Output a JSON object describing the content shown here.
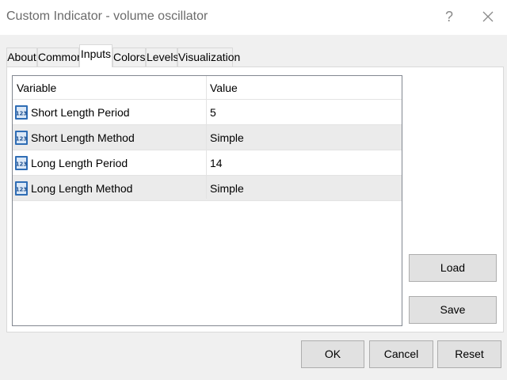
{
  "window": {
    "title": "Custom Indicator - volume oscillator",
    "help_glyph": "?",
    "close_glyph": "×"
  },
  "tabs": [
    {
      "label": "About",
      "active": false
    },
    {
      "label": "Common",
      "active": false
    },
    {
      "label": "Inputs",
      "active": true
    },
    {
      "label": "Colors",
      "active": false
    },
    {
      "label": "Levels",
      "active": false
    },
    {
      "label": "Visualization",
      "active": false
    }
  ],
  "inputs_table": {
    "headers": {
      "variable": "Variable",
      "value": "Value"
    },
    "rows": [
      {
        "variable": "Short Length Period",
        "value": "5",
        "icon": "numeric-123-icon"
      },
      {
        "variable": "Short Length Method",
        "value": "Simple",
        "icon": "numeric-123-icon"
      },
      {
        "variable": "Long Length Period",
        "value": "14",
        "icon": "numeric-123-icon"
      },
      {
        "variable": "Long Length Method",
        "value": "Simple",
        "icon": "numeric-123-icon"
      }
    ]
  },
  "side_buttons": {
    "load": "Load",
    "save": "Save"
  },
  "footer_buttons": {
    "ok": "OK",
    "cancel": "Cancel",
    "reset": "Reset"
  },
  "colors": {
    "row_shade": "#ebebeb",
    "icon_blue": "#2f6db5",
    "button_face": "#e1e1e1"
  }
}
